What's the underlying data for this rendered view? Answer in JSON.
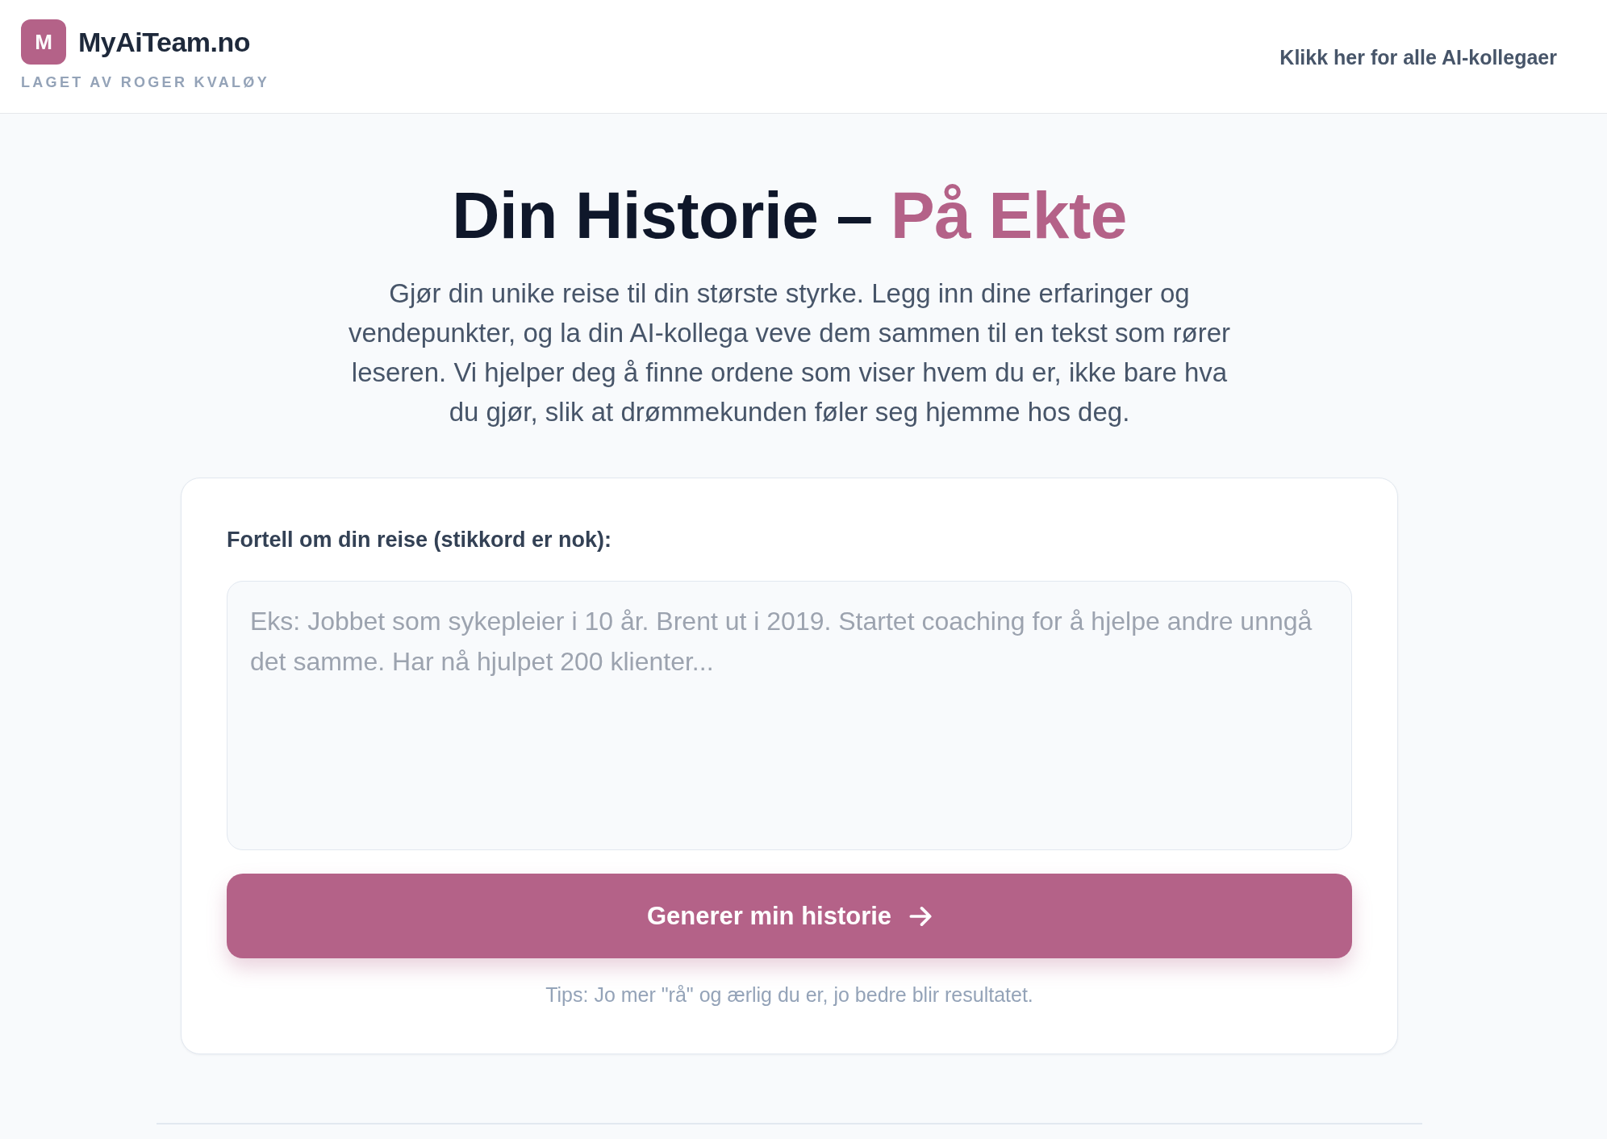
{
  "header": {
    "logo": {
      "letter": "M",
      "name": "MyAiTeam.no",
      "tagline": "LAGET AV ROGER KVALØY"
    },
    "nav_link": "Klikk her for alle AI-kollegaer"
  },
  "hero": {
    "title": "Din Historie –",
    "title_highlight": "På Ekte",
    "intro": "Gjør din unike reise til din største styrke. Legg inn dine erfaringer og vendepunkter, og la din AI-kollega veve dem sammen til en tekst som rører leseren. Vi hjelper deg å finne ordene som viser hvem du er, ikke bare hva du gjør, slik at drømmekunden føler seg hjemme hos deg."
  },
  "form": {
    "label": "Fortell om din reise (stikkord er nok):",
    "story_field": {
      "placeholder": "Eks: Jobbet som sykepleier i 10 år. Brent ut i 2019. Startet coaching for å hjelpe andre unngå det samme. Har nå hjulpet 200 klienter..."
    },
    "submit_button": "Generer min historie",
    "tip": "Tips: Jo mer \"rå\" og ærlig du er, jo bedre blir resultatet."
  }
}
